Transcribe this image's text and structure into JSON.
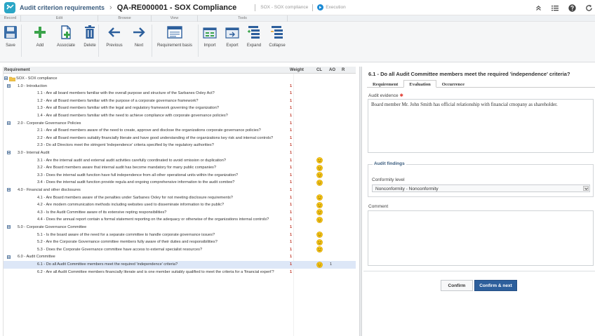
{
  "titlebar": {
    "module": "Audit criterion requirements",
    "separator": "›",
    "record": "QA-RE000001 - SOX Compliance",
    "context": "SOX - SOX compliance",
    "status": "Execution"
  },
  "ribbon_groups": [
    "Record",
    "Edit",
    "Browse",
    "View",
    "Tools"
  ],
  "ribbon_buttons": {
    "save": "Save",
    "add": "Add",
    "associate": "Associate",
    "delete": "Delete",
    "previous": "Previous",
    "next": "Next",
    "requirement_basis": "Requirement basis",
    "import": "Import",
    "export": "Export",
    "expand": "Expand",
    "collapse": "Collapse"
  },
  "grid": {
    "headers": {
      "requirement": "Requirement",
      "weight": "Weight",
      "cl": "CL",
      "ao": "AO",
      "r": "R"
    },
    "rows": [
      {
        "level": 0,
        "text": "SOX - SOX compliance",
        "weight": "",
        "cl": false,
        "ao": ""
      },
      {
        "level": 1,
        "text": "1.0 - Introduction",
        "weight": "1",
        "cl": false,
        "ao": ""
      },
      {
        "level": 2,
        "text": "1.1 - Are all board members familiar with the overall purpose and structure of the Sarbanes Oxley Act?",
        "weight": "1",
        "cl": false,
        "ao": ""
      },
      {
        "level": 2,
        "text": "1.2 - Are all Board members familiar with the purpose of a corporate governance framework?",
        "weight": "1",
        "cl": false,
        "ao": ""
      },
      {
        "level": 2,
        "text": "1.3 - Are all Board members familiar with the legal and regulatory framework governing the organization?",
        "weight": "1",
        "cl": false,
        "ao": ""
      },
      {
        "level": 2,
        "text": "1.4 - Are all Board members familiar with the need to achieve compliance with corporate governance policies?",
        "weight": "1",
        "cl": false,
        "ao": ""
      },
      {
        "level": 1,
        "text": "2.0 - Corporate Governance Policies",
        "weight": "1",
        "cl": false,
        "ao": ""
      },
      {
        "level": 2,
        "text": "2.1 - Are all Board members aware of the need to create, approve and disclose the organizations corporate governance policies?",
        "weight": "1",
        "cl": false,
        "ao": ""
      },
      {
        "level": 2,
        "text": "2.2 - Are all Board members suitably financially literate and have good understanding of the organizations key risk and internal controls?",
        "weight": "1",
        "cl": false,
        "ao": ""
      },
      {
        "level": 2,
        "text": "2.3 - Do all Directors meet the stringent 'independence' criteria specified by the regulatory authorities?",
        "weight": "1",
        "cl": false,
        "ao": ""
      },
      {
        "level": 1,
        "text": "3.0 - Internal Audit",
        "weight": "1",
        "cl": false,
        "ao": ""
      },
      {
        "level": 2,
        "text": "3.1 - Are the internal audit and external audit activities carefully coordinated to avoid omission or duplication?",
        "weight": "1",
        "cl": true,
        "ao": ""
      },
      {
        "level": 2,
        "text": "3.2 - Are Board members aware that internal audit has become mandatory for many public companies?",
        "weight": "1",
        "cl": true,
        "ao": ""
      },
      {
        "level": 2,
        "text": "3.3 - Does the internal audit function have full independence from all other operational units within the organization?",
        "weight": "1",
        "cl": true,
        "ao": ""
      },
      {
        "level": 2,
        "text": "3.4 - Does the internal audit function provide regula and ongoing comprehensive information to the audit comitee?",
        "weight": "1",
        "cl": true,
        "ao": ""
      },
      {
        "level": 1,
        "text": "4.0 - Financial and other disclosures",
        "weight": "1",
        "cl": false,
        "ao": ""
      },
      {
        "level": 2,
        "text": "4.1 - Are Board members aware of the penalties under Sarbanes Oxley for not meeting disclosure requirements?",
        "weight": "1",
        "cl": true,
        "ao": ""
      },
      {
        "level": 2,
        "text": "4.2 - Are modern communication methods including websites used to disseminate information to the public?",
        "weight": "1",
        "cl": true,
        "ao": ""
      },
      {
        "level": 2,
        "text": "4.3 - Is the Audit Committee aware of its extensive repting responsibilities?",
        "weight": "1",
        "cl": true,
        "ao": ""
      },
      {
        "level": 2,
        "text": "4.4 - Does the annual report contain a formal statement reporting on the adequacy or otherwise of the organizations internal controls?",
        "weight": "1",
        "cl": true,
        "ao": ""
      },
      {
        "level": 1,
        "text": "5.0 - Corporate Governance Committee",
        "weight": "1",
        "cl": false,
        "ao": ""
      },
      {
        "level": 2,
        "text": "5.1 - Is the board aware of the need for a separate committee to handle corporate governance issues?",
        "weight": "1",
        "cl": true,
        "ao": ""
      },
      {
        "level": 2,
        "text": "5.2 - Are the Corporate Governance committee members fully aware of their duties and responsibilities?",
        "weight": "1",
        "cl": true,
        "ao": ""
      },
      {
        "level": 2,
        "text": "5.3 - Does the Corporate Governance committee have access to external specialist resources?",
        "weight": "1",
        "cl": true,
        "ao": ""
      },
      {
        "level": 1,
        "text": "6.0 - Audit Committee",
        "weight": "1",
        "cl": false,
        "ao": ""
      },
      {
        "level": 2,
        "text": "6.1 - Do all Audit Committee members meet the required 'independence' criteria?",
        "weight": "1",
        "cl": true,
        "ao": "1",
        "selected": true
      },
      {
        "level": 2,
        "text": "6.2 - Are all Audit Committee members financially literate and is one member suitably qualified to meet the criteria for a 'financial expert'?",
        "weight": "1",
        "cl": false,
        "ao": ""
      }
    ]
  },
  "detail": {
    "title": "6.1 - Do all Audit Committee members meet the required 'independence' criteria?",
    "tabs": [
      "Requirement",
      "Evaluation",
      "Occurrence"
    ],
    "audit_evidence_label": "Audit evidence",
    "required_mark": "✱",
    "audit_evidence_value": "Board member Mr. John Smith has official relationship with financial cmopany as shareholder.",
    "audit_findings_legend": "Audit findings",
    "conformity_label": "Conformity level",
    "conformity_value": "Nonconformity - Nonconformity",
    "comment_label": "Comment",
    "comment_value": "",
    "confirm": "Confirm",
    "confirm_next": "Confirm & next"
  },
  "colors": {
    "accent": "#2d5f9c",
    "weight_red": "#c0392b",
    "smiley": "#f5c518",
    "selection": "#dde7f7"
  }
}
